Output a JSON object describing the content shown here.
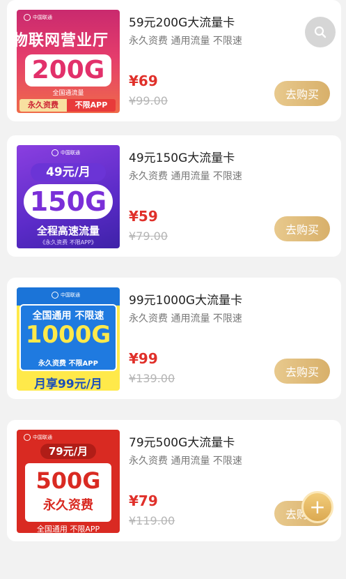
{
  "products": [
    {
      "title": "59元200G大流量卡",
      "desc": "永久资费 通用流量 不限速",
      "price": "¥69",
      "original_price": "¥99.00",
      "buy_label": "去购买",
      "thumb": {
        "logo": "中国联通",
        "banner": "物联网营业厅",
        "big": "200G",
        "small": "全国通流量",
        "tag_left": "永久资费",
        "tag_right": "不限APP"
      }
    },
    {
      "title": "49元150G大流量卡",
      "desc": "永久资费 通用流量 不限速",
      "price": "¥59",
      "original_price": "¥79.00",
      "buy_label": "去购买",
      "thumb": {
        "logo": "中国联通",
        "month": "49元/月",
        "big": "150G",
        "sub": "全程高速流量",
        "tiny": "《永久资费 不限APP》"
      }
    },
    {
      "title": "99元1000G大流量卡",
      "desc": "永久资费 通用流量 不限速",
      "price": "¥99",
      "original_price": "¥139.00",
      "buy_label": "去购买",
      "thumb": {
        "logo": "中国联通",
        "line1": "全国通用 不限速",
        "big": "1000G",
        "line3": "永久资费 不限APP",
        "line4": "月享99元/月"
      }
    },
    {
      "title": "79元500G大流量卡",
      "desc": "永久资费 通用流量 不限速",
      "price": "¥79",
      "original_price": "¥119.00",
      "buy_label": "去购买",
      "thumb": {
        "logo": "中国联通",
        "month": "79元/月",
        "big": "500G",
        "sub": "永久资费",
        "bottom": "全国通用 不限APP"
      }
    }
  ],
  "fabs": {
    "search_icon": "search-icon",
    "add_icon": "plus-icon",
    "add_symbol": "+"
  },
  "colors": {
    "price": "#e0302a",
    "buy_button": "#d8b06a",
    "background": "#f2f2f2"
  }
}
